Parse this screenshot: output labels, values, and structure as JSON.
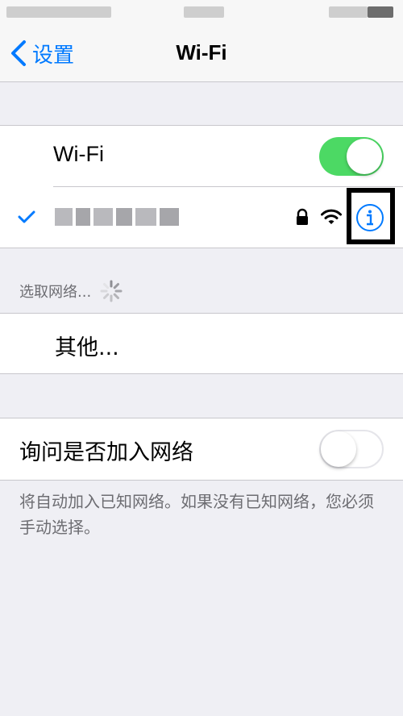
{
  "nav": {
    "back_label": "设置",
    "title": "Wi-Fi"
  },
  "wifi_section": {
    "wifi_label": "Wi-Fi",
    "wifi_enabled": true,
    "connected_network": {
      "selected": true,
      "secured": true,
      "info_icon": "info-circle-icon"
    }
  },
  "choose_section": {
    "header": "选取网络...",
    "other_label": "其他..."
  },
  "ask_section": {
    "ask_label": "询问是否加入网络",
    "ask_enabled": false,
    "footer": "将自动加入已知网络。如果没有已知网络，您必须手动选择。"
  },
  "colors": {
    "accent": "#007aff",
    "toggle_on": "#4cd964",
    "background": "#efeff4",
    "secondary_text": "#6d6d72",
    "highlight_box": "#000000"
  }
}
